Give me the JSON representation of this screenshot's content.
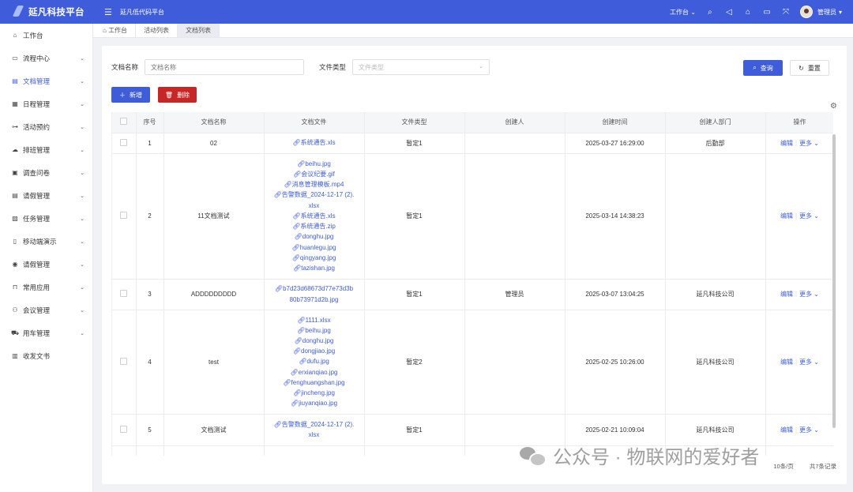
{
  "header": {
    "title": "延凡科技平台",
    "system_name": "延凡低代码平台",
    "workspace_label": "工作台",
    "user_name": "管理员"
  },
  "sidebar": {
    "items": [
      {
        "label": "工作台",
        "icon": "home-icon"
      },
      {
        "label": "流程中心",
        "icon": "monitor-icon"
      },
      {
        "label": "文档管理",
        "icon": "document-icon"
      },
      {
        "label": "日程管理",
        "icon": "calendar-icon"
      },
      {
        "label": "活动预约",
        "icon": "org-icon"
      },
      {
        "label": "排班管理",
        "icon": "cloud-icon"
      },
      {
        "label": "调查问卷",
        "icon": "form-icon"
      },
      {
        "label": "请假管理",
        "icon": "message-icon"
      },
      {
        "label": "任务管理",
        "icon": "image-icon"
      },
      {
        "label": "移动端演示",
        "icon": "mobile-icon"
      },
      {
        "label": "请假管理",
        "icon": "circle-icon"
      },
      {
        "label": "常用应用",
        "icon": "bag-icon"
      },
      {
        "label": "会议管理",
        "icon": "people-icon"
      },
      {
        "label": "用车管理",
        "icon": "truck-icon"
      },
      {
        "label": "收发文书",
        "icon": "book-icon"
      }
    ]
  },
  "tabs": [
    {
      "label": "工作台"
    },
    {
      "label": "活动列表"
    },
    {
      "label": "文档列表"
    }
  ],
  "search": {
    "name_label": "文档名称",
    "name_placeholder": "文档名称",
    "type_label": "文件类型",
    "type_placeholder": "文件类型",
    "query_label": "查询",
    "reset_label": "重置"
  },
  "toolbar": {
    "add_label": "新增",
    "delete_label": "删除"
  },
  "table": {
    "columns": [
      "序号",
      "文档名称",
      "文档文件",
      "文件类型",
      "创建人",
      "创建时间",
      "创建人部门",
      "操作"
    ],
    "edit_label": "编辑",
    "more_label": "更多",
    "rows": [
      {
        "index": "1",
        "name": "02",
        "files": [
          "系统通告.xls"
        ],
        "type": "暂定1",
        "creator": "",
        "time": "2025-03-27 16:29:00",
        "dept": "后勤部"
      },
      {
        "index": "2",
        "name": "11文档测试",
        "files": [
          "beihu.jpg",
          "会议纪要.gif",
          "消息管理模板.mp4",
          "告警数据_2024-12-17 (2).",
          "xlsx",
          "系统通告.xls",
          "系统通告.zip",
          "donghu.jpg",
          "huanlegu.jpg",
          "qingyang.jpg",
          "tazishan.jpg"
        ],
        "type": "暂定1",
        "creator": "",
        "time": "2025-03-14 14:38:23",
        "dept": ""
      },
      {
        "index": "3",
        "name": "ADDDDDDDDD",
        "files": [
          "b7d23d68673d77e73d3b",
          "80b73971d2b.jpg"
        ],
        "type": "暂定1",
        "creator": "管理员",
        "time": "2025-03-07 13:04:25",
        "dept": "延凡科技公司"
      },
      {
        "index": "4",
        "name": "test",
        "files": [
          "1111.xlsx",
          "beihu.jpg",
          "donghu.jpg",
          "dongjiao.jpg",
          "dufu.jpg",
          "erxianqiao.jpg",
          "fenghuangshan.jpg",
          "jincheng.jpg",
          "jiuyanqiao.jpg"
        ],
        "type": "暂定2",
        "creator": "",
        "time": "2025-02-25 10:26:00",
        "dept": "延凡科技公司"
      },
      {
        "index": "5",
        "name": "文档测试",
        "files": [
          "告警数据_2024-12-17 (2).",
          "xlsx"
        ],
        "type": "暂定1",
        "creator": "",
        "time": "2025-02-21 10:09:04",
        "dept": "延凡科技公司"
      }
    ]
  },
  "footer": {
    "page_size": "10条/页",
    "total": "共7条记录"
  },
  "watermark": "公众号 · 物联网的爱好者"
}
